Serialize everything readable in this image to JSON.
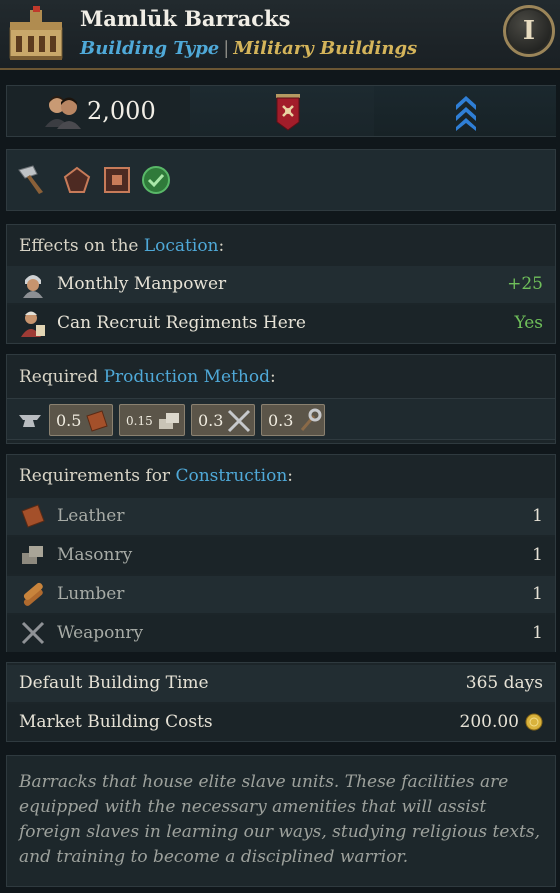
{
  "header": {
    "title": "Mamlūk Barracks",
    "building_type_label": "Building Type",
    "separator": "|",
    "category": "Military Buildings",
    "era_label": "I"
  },
  "stats": {
    "pop_value": "2,000",
    "icons": [
      "population-icon",
      "military-banner-icon",
      "rank-chevrons-icon"
    ]
  },
  "tags": {
    "icons": [
      "hammer-icon",
      "pentagon-badge-icon",
      "square-badge-icon",
      "green-check-icon"
    ]
  },
  "effects": {
    "title_prefix": "Effects on the ",
    "title_highlight": "Location",
    "title_suffix": ":",
    "rows": [
      {
        "label": "Monthly Manpower",
        "value": "+25",
        "icon": "soldier-portrait-icon"
      },
      {
        "label": "Can Recruit Regiments Here",
        "value": "Yes",
        "icon": "recruit-portrait-icon"
      }
    ]
  },
  "production": {
    "title_prefix": "Required ",
    "title_highlight": "Production Method",
    "title_suffix": ":",
    "items": [
      {
        "value": "0.5",
        "icon": "leather-icon"
      },
      {
        "value": "0.15",
        "icon": "masonry-icon"
      },
      {
        "value": "0.3",
        "icon": "weaponry-icon"
      },
      {
        "value": "0.3",
        "icon": "tools-icon"
      }
    ]
  },
  "construction": {
    "title_prefix": "Requirements for ",
    "title_highlight": "Construction",
    "title_suffix": ":",
    "rows": [
      {
        "label": "Leather",
        "value": "1",
        "icon": "leather-icon"
      },
      {
        "label": "Masonry",
        "value": "1",
        "icon": "masonry-icon"
      },
      {
        "label": "Lumber",
        "value": "1",
        "icon": "lumber-icon"
      },
      {
        "label": "Weaponry",
        "value": "1",
        "icon": "weaponry-icon"
      }
    ]
  },
  "costs": {
    "rows": [
      {
        "label": "Default Building Time",
        "value": "365 days"
      },
      {
        "label": "Market Building Costs",
        "value": "200.00"
      }
    ]
  },
  "description": "Barracks that house elite slave units. These facilities are equipped with the necessary amenities that will assist foreign slaves in learning our ways, studying religious texts, and training to become a disciplined warrior.",
  "colors": {
    "accent_blue": "#4fa9d8",
    "accent_gold": "#d4b45a",
    "positive_green": "#6fbf5a"
  }
}
